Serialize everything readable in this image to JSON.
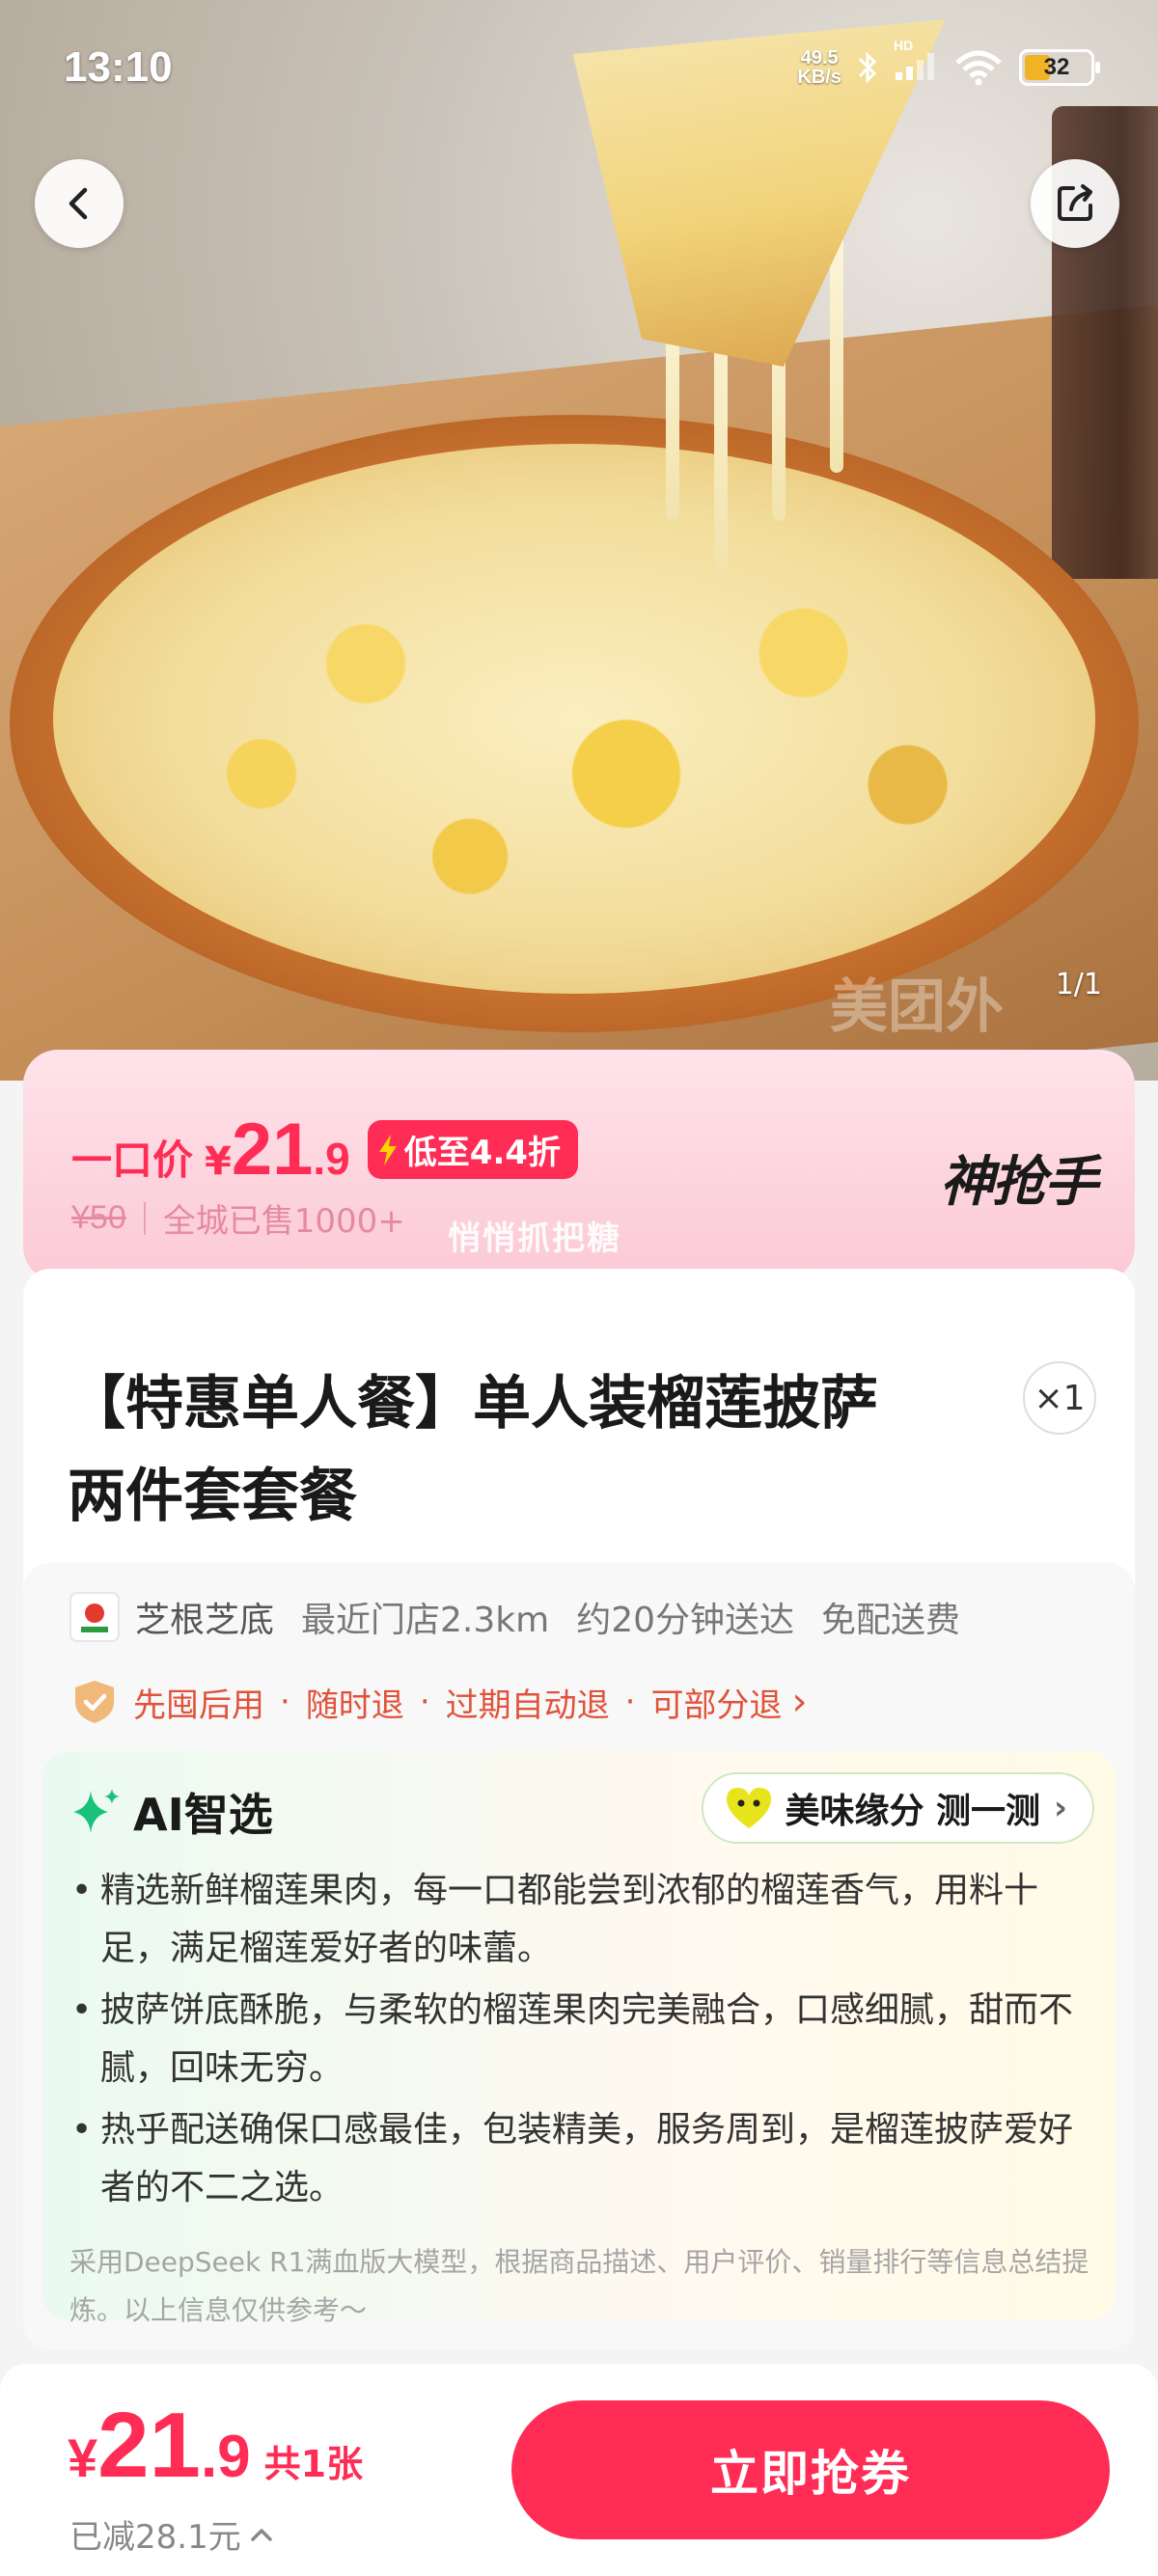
{
  "status_bar": {
    "time": "13:10",
    "net_speed_value": "49.5",
    "net_speed_unit": "KB/s",
    "network_tag": "HD",
    "battery_level": "32"
  },
  "gallery": {
    "counter": "1/1",
    "watermark": "美团外"
  },
  "price_banner": {
    "prefix": "一口价",
    "currency": "¥",
    "price_int": "21",
    "price_dec": ".9",
    "discount_tag": "低至4.4折",
    "original_price": "¥50",
    "sold_text": "全城已售1000+",
    "slogan": "悄悄抓把糖",
    "brand": "神抢手"
  },
  "product": {
    "title_line1": "【特惠单人餐】单人装榴莲披萨",
    "title_line2": "两件套套餐",
    "quantity": "×1"
  },
  "store": {
    "logo_text": "芝根芝底",
    "name": "芝根芝底",
    "distance": "最近门店2.3km",
    "delivery_time": "约20分钟送达",
    "delivery_fee": "免配送费"
  },
  "policy": {
    "items": [
      "先囤后用",
      "随时退",
      "过期自动退",
      "可部分退"
    ],
    "separator": "·",
    "chevron": "›"
  },
  "ai": {
    "title": "AI智选",
    "taste_button": "美味缘分 测一测",
    "bullets": [
      "精选新鲜榴莲果肉，每一口都能尝到浓郁的榴莲香气，用料十足，满足榴莲爱好者的味蕾。",
      "披萨饼底酥脆，与柔软的榴莲果肉完美融合，口感细腻，甜而不腻，回味无穷。",
      "热乎配送确保口感最佳，包装精美，服务周到，是榴莲披萨爱好者的不二之选。"
    ],
    "disclaimer": "采用DeepSeek R1满血版大模型，根据商品描述、用户评价、销量排行等信息总结提炼。以上信息仅供参考～"
  },
  "bottom_bar": {
    "currency": "¥",
    "price_int": "21",
    "price_dec": ".9",
    "count": "共1张",
    "saved": "已减28.1元",
    "buy_button": "立即抢券"
  },
  "colors": {
    "accent": "#ff2d55",
    "policy": "#e0523a",
    "banner_bg": "#fbd3dd"
  }
}
